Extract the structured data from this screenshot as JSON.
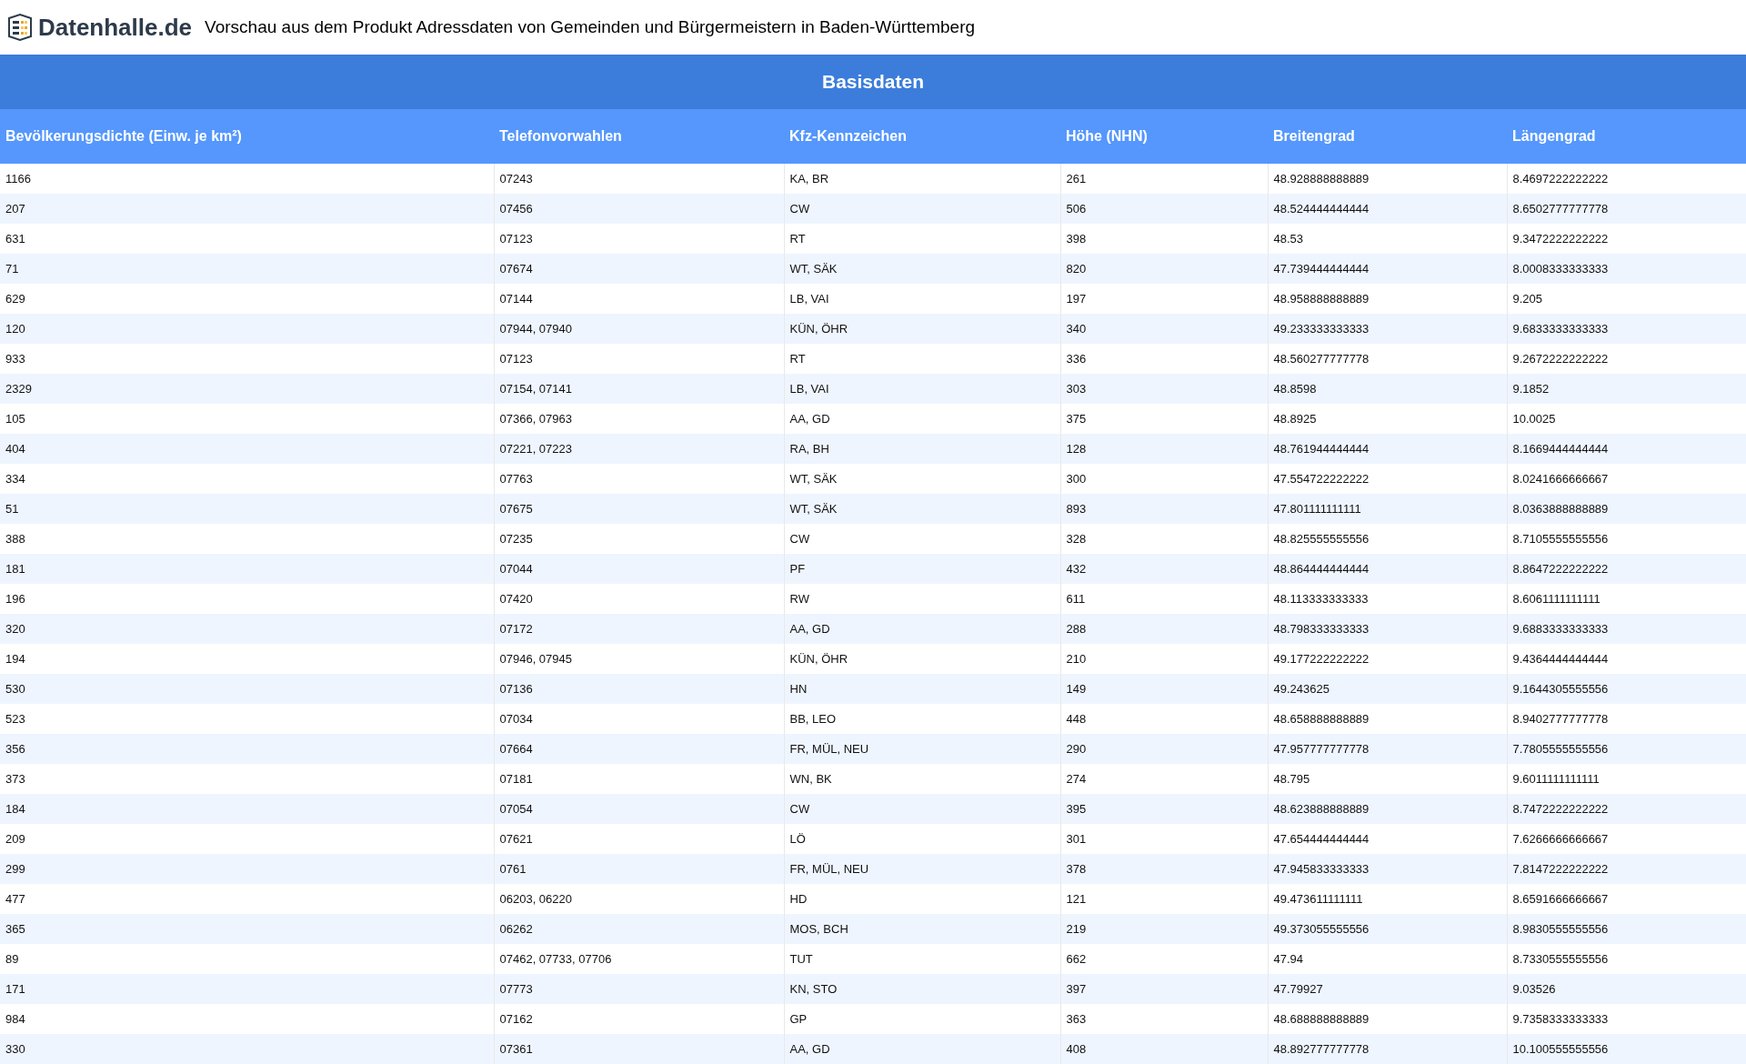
{
  "header": {
    "logo_text": "Datenhalle.de",
    "title": "Vorschau aus dem Produkt Adressdaten von Gemeinden und Bürgermeistern in Baden-Württemberg"
  },
  "table": {
    "caption": "Basisdaten",
    "columns": [
      "Bevölkerungsdichte (Einw. je km²)",
      "Telefonvorwahlen",
      "Kfz-Kennzeichen",
      "Höhe (NHN)",
      "Breitengrad",
      "Längengrad"
    ],
    "rows": [
      [
        "1166",
        "07243",
        "KA, BR",
        "261",
        "48.928888888889",
        "8.4697222222222"
      ],
      [
        "207",
        "07456",
        "CW",
        "506",
        "48.524444444444",
        "8.6502777777778"
      ],
      [
        "631",
        "07123",
        "RT",
        "398",
        "48.53",
        "9.3472222222222"
      ],
      [
        "71",
        "07674",
        "WT, SÄK",
        "820",
        "47.739444444444",
        "8.0008333333333"
      ],
      [
        "629",
        "07144",
        "LB, VAI",
        "197",
        "48.958888888889",
        "9.205"
      ],
      [
        "120",
        "07944, 07940",
        "KÜN, ÖHR",
        "340",
        "49.233333333333",
        "9.6833333333333"
      ],
      [
        "933",
        "07123",
        "RT",
        "336",
        "48.560277777778",
        "9.2672222222222"
      ],
      [
        "2329",
        "07154, 07141",
        "LB, VAI",
        "303",
        "48.8598",
        "9.1852"
      ],
      [
        "105",
        "07366, 07963",
        "AA, GD",
        "375",
        "48.8925",
        "10.0025"
      ],
      [
        "404",
        "07221, 07223",
        "RA, BH",
        "128",
        "48.761944444444",
        "8.1669444444444"
      ],
      [
        "334",
        "07763",
        "WT, SÄK",
        "300",
        "47.554722222222",
        "8.0241666666667"
      ],
      [
        "51",
        "07675",
        "WT, SÄK",
        "893",
        "47.801111111111",
        "8.0363888888889"
      ],
      [
        "388",
        "07235",
        "CW",
        "328",
        "48.825555555556",
        "8.7105555555556"
      ],
      [
        "181",
        "07044",
        "PF",
        "432",
        "48.864444444444",
        "8.8647222222222"
      ],
      [
        "196",
        "07420",
        "RW",
        "611",
        "48.113333333333",
        "8.6061111111111"
      ],
      [
        "320",
        "07172",
        "AA, GD",
        "288",
        "48.798333333333",
        "9.6883333333333"
      ],
      [
        "194",
        "07946, 07945",
        "KÜN, ÖHR",
        "210",
        "49.177222222222",
        "9.4364444444444"
      ],
      [
        "530",
        "07136",
        "HN",
        "149",
        "49.243625",
        "9.1644305555556"
      ],
      [
        "523",
        "07034",
        "BB, LEO",
        "448",
        "48.658888888889",
        "8.9402777777778"
      ],
      [
        "356",
        "07664",
        "FR, MÜL, NEU",
        "290",
        "47.957777777778",
        "7.7805555555556"
      ],
      [
        "373",
        "07181",
        "WN, BK",
        "274",
        "48.795",
        "9.6011111111111"
      ],
      [
        "184",
        "07054",
        "CW",
        "395",
        "48.623888888889",
        "8.7472222222222"
      ],
      [
        "209",
        "07621",
        "LÖ",
        "301",
        "47.654444444444",
        "7.6266666666667"
      ],
      [
        "299",
        "0761",
        "FR, MÜL, NEU",
        "378",
        "47.945833333333",
        "7.8147222222222"
      ],
      [
        "477",
        "06203, 06220",
        "HD",
        "121",
        "49.473611111111",
        "8.6591666666667"
      ],
      [
        "365",
        "06262",
        "MOS, BCH",
        "219",
        "49.373055555556",
        "8.9830555555556"
      ],
      [
        "89",
        "07462, 07733, 07706",
        "TUT",
        "662",
        "47.94",
        "8.7330555555556"
      ],
      [
        "171",
        "07773",
        "KN, STO",
        "397",
        "47.79927",
        "9.03526"
      ],
      [
        "984",
        "07162",
        "GP",
        "363",
        "48.688888888889",
        "9.7358333333333"
      ],
      [
        "330",
        "07361",
        "AA, GD",
        "408",
        "48.892777777778",
        "10.100555555556"
      ]
    ]
  }
}
